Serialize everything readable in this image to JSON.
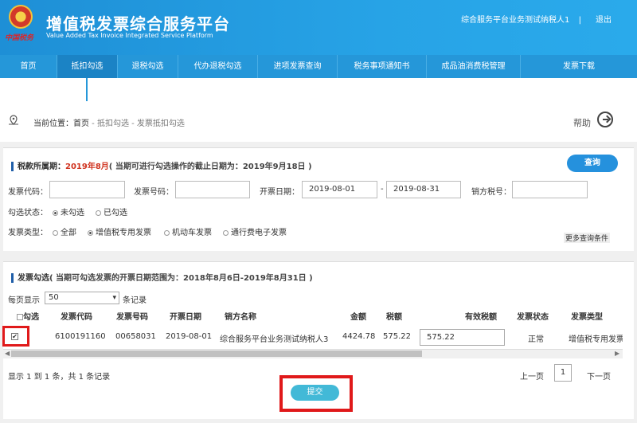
{
  "header": {
    "brand_script": "中国税务",
    "title": "增值税发票综合服务平台",
    "subtitle": "Value Added Tax Invoice Integrated Service Platform",
    "user": "综合服务平台业务测试纳税人1",
    "separator": "|",
    "logout": "退出"
  },
  "nav": [
    "首页",
    "抵扣勾选",
    "退税勾选",
    "代办退税勾选",
    "进项发票查询",
    "税务事项通知书",
    "成品油消费税管理",
    "发票下载"
  ],
  "breadcrumb": {
    "prefix": "当前位置：",
    "home": "首页",
    "path": " - 抵扣勾选 - 发票抵扣勾选",
    "help": "帮助"
  },
  "filter": {
    "period_label": "税款所属期：",
    "period_value": "2019年8月",
    "period_note": "( 当期可进行勾选操作的截止日期为：2019年9月18日 )",
    "query_button": "查询",
    "invoice_code_label": "发票代码：",
    "invoice_number_label": "发票号码：",
    "issue_date_label": "开票日期：",
    "date_from": "2019-08-01",
    "date_sep": "-",
    "date_to": "2019-08-31",
    "seller_tax_label": "销方税号：",
    "status_label": "勾选状态：",
    "status_options": [
      "未勾选",
      "已勾选"
    ],
    "type_label": "发票类型：",
    "type_options": [
      "全部",
      "增值税专用发票",
      "机动车发票",
      "通行费电子发票"
    ],
    "more": "更多查询条件"
  },
  "selection": {
    "title": "发票勾选",
    "note": "( 当期可勾选发票的开票日期范围为：2018年8月6日-2019年8月31日 )",
    "per_page_label": "每页显示",
    "per_page_value": "50",
    "per_page_suffix": "条记录",
    "columns": [
      "勾选",
      "发票代码",
      "发票号码",
      "开票日期",
      "销方名称",
      "金额",
      "税额",
      "有效税额",
      "发票状态",
      "发票类型"
    ],
    "rows": [
      {
        "check": "✔",
        "code": "6100191160",
        "number": "00658031",
        "date": "2019-08-01",
        "seller": "综合服务平台业务测试纳税人3",
        "amount": "4424.78",
        "tax": "575.22",
        "effective_tax": "575.22",
        "status": "正常",
        "type": "增值税专用发票"
      }
    ],
    "footer": "显示 1 到 1 条，共 1 条记录",
    "prev": "上一页",
    "page": "1",
    "next": "下一页",
    "submit": "提交"
  }
}
